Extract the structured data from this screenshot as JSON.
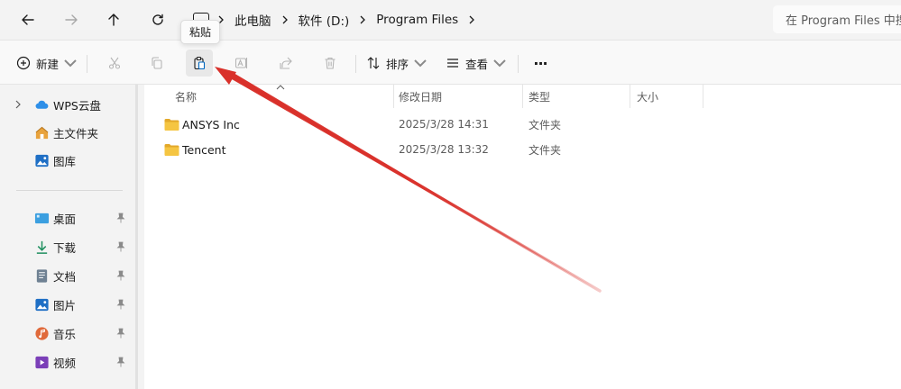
{
  "addressbar": {
    "breadcrumbs": [
      "此电脑",
      "软件 (D:)",
      "Program Files"
    ],
    "search_placeholder": "在 Program Files 中搜"
  },
  "toolbar": {
    "new_label": "新建",
    "sort_label": "排序",
    "view_label": "查看",
    "more_label": "···"
  },
  "tooltip": {
    "text": "粘贴"
  },
  "sidebar": {
    "top_items": [
      {
        "label": "WPS云盘",
        "icon": "cloud-icon"
      },
      {
        "label": "主文件夹",
        "icon": "home-icon"
      },
      {
        "label": "图库",
        "icon": "gallery-icon"
      }
    ],
    "quick_items": [
      {
        "label": "桌面",
        "icon": "desktop-icon"
      },
      {
        "label": "下载",
        "icon": "download-icon"
      },
      {
        "label": "文档",
        "icon": "document-icon"
      },
      {
        "label": "图片",
        "icon": "pictures-icon"
      },
      {
        "label": "音乐",
        "icon": "music-icon"
      },
      {
        "label": "视频",
        "icon": "video-icon"
      }
    ]
  },
  "columns": {
    "name": "名称",
    "date": "修改日期",
    "type": "类型",
    "size": "大小"
  },
  "files": [
    {
      "name": "ANSYS Inc",
      "date": "2025/3/28 14:31",
      "type": "文件夹"
    },
    {
      "name": "Tencent",
      "date": "2025/3/28 13:32",
      "type": "文件夹"
    }
  ],
  "colors": {
    "folder": "#f5c542",
    "arrow": "#d9302a",
    "accent": "#0067c0"
  }
}
